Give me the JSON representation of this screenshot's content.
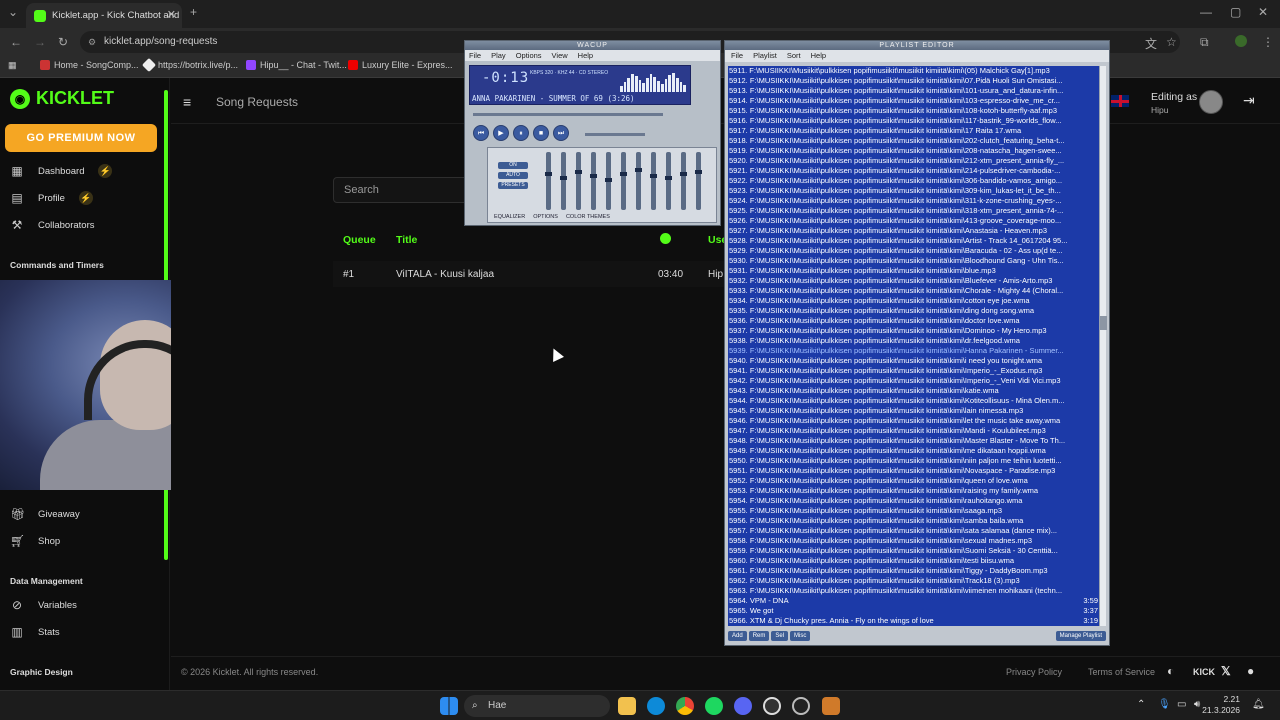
{
  "browser": {
    "tab_title": "Kicklet.app - Kick Chatbot and",
    "url": "kicklet.app/song-requests",
    "bookmarks": [
      "Home - SongComp...",
      "https://botrix.live/p...",
      "Hipu__ - Chat - Twit...",
      "Luxury Elite - Expres..."
    ]
  },
  "app": {
    "logo": "KICKLET",
    "premium": "GO PREMIUM NOW",
    "nav": {
      "dashboard": "Dashboard",
      "profile": "Profile",
      "collaborators": "Collaborators",
      "commands_section": "Commands and Timers",
      "giveaway": "Giveaway",
      "shop": "Shop",
      "data_section": "Data Management",
      "variables": "Variables",
      "stats": "Stats",
      "graphic_section": "Graphic Design"
    },
    "page_title": "Song Requests",
    "editing_as": "Editing as",
    "editing_user": "Hipu",
    "search_placeholder": "Search",
    "columns": {
      "queue": "Queue",
      "title": "Title",
      "user": "Use"
    },
    "row": {
      "queue": "#1",
      "title": "ViITALA - Kuusi kaljaa",
      "duration": "03:40",
      "user": "Hip"
    },
    "footer": {
      "copyright": "© 2026 Kicklet. All rights reserved.",
      "privacy": "Privacy Policy",
      "terms": "Terms of Service"
    }
  },
  "wacup": {
    "title": "WACUP",
    "menu": [
      "File",
      "Play",
      "Options",
      "View",
      "Help"
    ],
    "time": "-0:13",
    "kbps": "KBPS 320 · KHZ 44 · CD STEREO",
    "song": "ANNA PAKARINEN - SUMMER OF 69 (3:26)",
    "eq_buttons": [
      "ON",
      "AUTO",
      "PRESETS"
    ],
    "eq_tabs": [
      "EQUALIZER",
      "OPTIONS",
      "COLOR THEMES"
    ]
  },
  "playlist": {
    "title": "PLAYLIST EDITOR",
    "menu": [
      "File",
      "Playlist",
      "Sort",
      "Help"
    ],
    "rows": [
      {
        "t": "5911. F:\\MUSIIKKI\\Musiikit\\pulkkisen popifimusiikit\\musiikit kimiitä\\kimi\\(05) Malchick Gay[1].mp3"
      },
      {
        "t": "5912. F:\\MUSIIKKI\\Musiikit\\pulkkisen popifimusiikit\\musiikit kimiitä\\kimi\\07.Pidä Huoli Sun Omistasi..."
      },
      {
        "t": "5913. F:\\MUSIIKKI\\Musiikit\\pulkkisen popifimusiikit\\musiikit kimiitä\\kimi\\101-usura_and_datura-infin..."
      },
      {
        "t": "5914. F:\\MUSIIKKI\\Musiikit\\pulkkisen popifimusiikit\\musiikit kimiitä\\kimi\\103-espresso-drive_me_cr..."
      },
      {
        "t": "5915. F:\\MUSIIKKI\\Musiikit\\pulkkisen popifimusiikit\\musiikit kimiitä\\kimi\\108-kotoh-butterfly-aaf.mp3"
      },
      {
        "t": "5916. F:\\MUSIIKKI\\Musiikit\\pulkkisen popifimusiikit\\musiikit kimiitä\\kimi\\117-bastrik_99-worlds_flow..."
      },
      {
        "t": "5917. F:\\MUSIIKKI\\Musiikit\\pulkkisen popifimusiikit\\musiikit kimiitä\\kimi\\17 Raita 17.wma"
      },
      {
        "t": "5918. F:\\MUSIIKKI\\Musiikit\\pulkkisen popifimusiikit\\musiikit kimiitä\\kimi\\202-clutch_featuring_beha-t..."
      },
      {
        "t": "5919. F:\\MUSIIKKI\\Musiikit\\pulkkisen popifimusiikit\\musiikit kimiitä\\kimi\\208-natascha_hagen-swee..."
      },
      {
        "t": "5920. F:\\MUSIIKKI\\Musiikit\\pulkkisen popifimusiikit\\musiikit kimiitä\\kimi\\212-xtm_present_annia-fly_..."
      },
      {
        "t": "5921. F:\\MUSIIKKI\\Musiikit\\pulkkisen popifimusiikit\\musiikit kimiitä\\kimi\\214-pulsedriver-cambodia-..."
      },
      {
        "t": "5922. F:\\MUSIIKKI\\Musiikit\\pulkkisen popifimusiikit\\musiikit kimiitä\\kimi\\306-bandido-vamos_amigo..."
      },
      {
        "t": "5923. F:\\MUSIIKKI\\Musiikit\\pulkkisen popifimusiikit\\musiikit kimiitä\\kimi\\309-kim_lukas-let_it_be_th..."
      },
      {
        "t": "5924. F:\\MUSIIKKI\\Musiikit\\pulkkisen popifimusiikit\\musiikit kimiitä\\kimi\\311-k-zone-crushing_eyes-..."
      },
      {
        "t": "5925. F:\\MUSIIKKI\\Musiikit\\pulkkisen popifimusiikit\\musiikit kimiitä\\kimi\\318-xtm_present_annia-74-..."
      },
      {
        "t": "5926. F:\\MUSIIKKI\\Musiikit\\pulkkisen popifimusiikit\\musiikit kimiitä\\kimi\\413-groove_coverage-moo..."
      },
      {
        "t": "5927. F:\\MUSIIKKI\\Musiikit\\pulkkisen popifimusiikit\\musiikit kimiitä\\kimi\\Anastasia - Heaven.mp3"
      },
      {
        "t": "5928. F:\\MUSIIKKI\\Musiikit\\pulkkisen popifimusiikit\\musiikit kimiitä\\kimi\\Artist - Track 14_0617204 95..."
      },
      {
        "t": "5929. F:\\MUSIIKKI\\Musiikit\\pulkkisen popifimusiikit\\musiikit kimiitä\\kimi\\Baracuda - 02 - Ass up(d te..."
      },
      {
        "t": "5930. F:\\MUSIIKKI\\Musiikit\\pulkkisen popifimusiikit\\musiikit kimiitä\\kimi\\Bloodhound Gang - Uhn Tis..."
      },
      {
        "t": "5931. F:\\MUSIIKKI\\Musiikit\\pulkkisen popifimusiikit\\musiikit kimiitä\\kimi\\blue.mp3"
      },
      {
        "t": "5932. F:\\MUSIIKKI\\Musiikit\\pulkkisen popifimusiikit\\musiikit kimiitä\\kimi\\Bluefever - Amis-Arto.mp3"
      },
      {
        "t": "5933. F:\\MUSIIKKI\\Musiikit\\pulkkisen popifimusiikit\\musiikit kimiitä\\kimi\\Chorale - Mighty 44 (Choral..."
      },
      {
        "t": "5934. F:\\MUSIIKKI\\Musiikit\\pulkkisen popifimusiikit\\musiikit kimiitä\\kimi\\cotton eye joe.wma"
      },
      {
        "t": "5935. F:\\MUSIIKKI\\Musiikit\\pulkkisen popifimusiikit\\musiikit kimiitä\\kimi\\ding dong song.wma"
      },
      {
        "t": "5936. F:\\MUSIIKKI\\Musiikit\\pulkkisen popifimusiikit\\musiikit kimiitä\\kimi\\doctor love.wma"
      },
      {
        "t": "5937. F:\\MUSIIKKI\\Musiikit\\pulkkisen popifimusiikit\\musiikit kimiitä\\kimi\\Dominoo - My Hero.mp3"
      },
      {
        "t": "5938. F:\\MUSIIKKI\\Musiikit\\pulkkisen popifimusiikit\\musiikit kimiitä\\kimi\\dr.feelgood.wma"
      },
      {
        "t": "5939. F:\\MUSIIKKI\\Musiikit\\pulkkisen popifimusiikit\\musiikit kimiitä\\kimi\\Hanna Pakarinen - Summer...",
        "cur": true
      },
      {
        "t": "5940. F:\\MUSIIKKI\\Musiikit\\pulkkisen popifimusiikit\\musiikit kimiitä\\kimi\\i need you tonight.wma"
      },
      {
        "t": "5941. F:\\MUSIIKKI\\Musiikit\\pulkkisen popifimusiikit\\musiikit kimiitä\\kimi\\Imperio_-_Exodus.mp3"
      },
      {
        "t": "5942. F:\\MUSIIKKI\\Musiikit\\pulkkisen popifimusiikit\\musiikit kimiitä\\kimi\\Imperio_-_Veni Vidi Vici.mp3"
      },
      {
        "t": "5943. F:\\MUSIIKKI\\Musiikit\\pulkkisen popifimusiikit\\musiikit kimiitä\\kimi\\katie.wma"
      },
      {
        "t": "5944. F:\\MUSIIKKI\\Musiikit\\pulkkisen popifimusiikit\\musiikit kimiitä\\kimi\\Kotiteollisuus - Minä Olen.m..."
      },
      {
        "t": "5945. F:\\MUSIIKKI\\Musiikit\\pulkkisen popifimusiikit\\musiikit kimiitä\\kimi\\lain nimessä.mp3"
      },
      {
        "t": "5946. F:\\MUSIIKKI\\Musiikit\\pulkkisen popifimusiikit\\musiikit kimiitä\\kimi\\let the music take away.wma"
      },
      {
        "t": "5947. F:\\MUSIIKKI\\Musiikit\\pulkkisen popifimusiikit\\musiikit kimiitä\\kimi\\Mandi - Koulubileet.mp3"
      },
      {
        "t": "5948. F:\\MUSIIKKI\\Musiikit\\pulkkisen popifimusiikit\\musiikit kimiitä\\kimi\\Master Blaster - Move To Th..."
      },
      {
        "t": "5949. F:\\MUSIIKKI\\Musiikit\\pulkkisen popifimusiikit\\musiikit kimiitä\\kimi\\me dikataan hoppii.wma"
      },
      {
        "t": "5950. F:\\MUSIIKKI\\Musiikit\\pulkkisen popifimusiikit\\musiikit kimiitä\\kimi\\niin paljon me teihin luotetti..."
      },
      {
        "t": "5951. F:\\MUSIIKKI\\Musiikit\\pulkkisen popifimusiikit\\musiikit kimiitä\\kimi\\Novaspace - Paradise.mp3"
      },
      {
        "t": "5952. F:\\MUSIIKKI\\Musiikit\\pulkkisen popifimusiikit\\musiikit kimiitä\\kimi\\queen of love.wma"
      },
      {
        "t": "5953. F:\\MUSIIKKI\\Musiikit\\pulkkisen popifimusiikit\\musiikit kimiitä\\kimi\\raising my family.wma"
      },
      {
        "t": "5954. F:\\MUSIIKKI\\Musiikit\\pulkkisen popifimusiikit\\musiikit kimiitä\\kimi\\rauhoitango.wma"
      },
      {
        "t": "5955. F:\\MUSIIKKI\\Musiikit\\pulkkisen popifimusiikit\\musiikit kimiitä\\kimi\\saaga.mp3"
      },
      {
        "t": "5956. F:\\MUSIIKKI\\Musiikit\\pulkkisen popifimusiikit\\musiikit kimiitä\\kimi\\samba baila.wma"
      },
      {
        "t": "5957. F:\\MUSIIKKI\\Musiikit\\pulkkisen popifimusiikit\\musiikit kimiitä\\kimi\\sata salamaa (dance mix)..."
      },
      {
        "t": "5958. F:\\MUSIIKKI\\Musiikit\\pulkkisen popifimusiikit\\musiikit kimiitä\\kimi\\sexual madnes.mp3"
      },
      {
        "t": "5959. F:\\MUSIIKKI\\Musiikit\\pulkkisen popifimusiikit\\musiikit kimiitä\\kimi\\Suomi Seksiä - 30 Centtiä..."
      },
      {
        "t": "5960. F:\\MUSIIKKI\\Musiikit\\pulkkisen popifimusiikit\\musiikit kimiitä\\kimi\\testi biisu.wma"
      },
      {
        "t": "5961. F:\\MUSIIKKI\\Musiikit\\pulkkisen popifimusiikit\\musiikit kimiitä\\kimi\\Tiggy - DaddyBoom.mp3"
      },
      {
        "t": "5962. F:\\MUSIIKKI\\Musiikit\\pulkkisen popifimusiikit\\musiikit kimiitä\\kimi\\Track18 (3).mp3"
      },
      {
        "t": "5963. F:\\MUSIIKKI\\Musiikit\\pulkkisen popifimusiikit\\musiikit kimiitä\\kimi\\viimeinen mohikaani (techn..."
      },
      {
        "t": "5964. VPM - DNA",
        "d": "3:59"
      },
      {
        "t": "5965. We got",
        "d": "3:37"
      },
      {
        "t": "5966. XTM & Dj Chucky pres. Annia - Fly on the wings of love",
        "d": "3:19"
      }
    ],
    "bottom": [
      "Add",
      "Rem",
      "Sel",
      "Misc",
      "Manage Playlist"
    ]
  },
  "taskbar": {
    "search": "Hae",
    "time": "2.21",
    "date": "21.3.2026"
  }
}
